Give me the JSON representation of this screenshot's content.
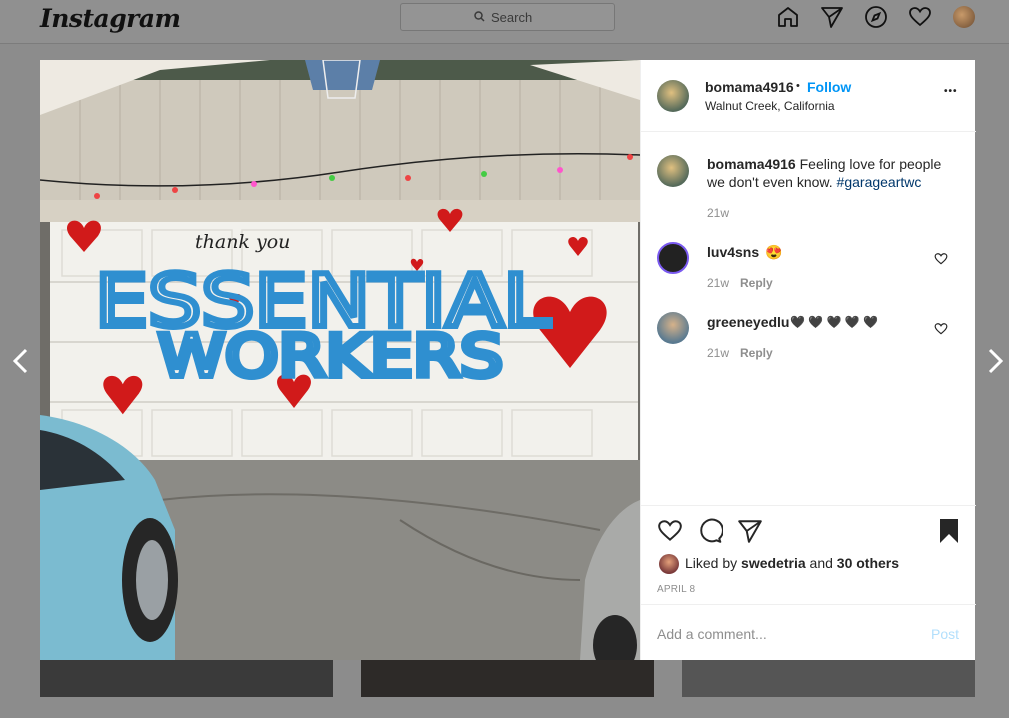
{
  "app": {
    "logo_text": "Instagram"
  },
  "topbar": {
    "search_placeholder": "Search",
    "icons": [
      "home-icon",
      "direct-icon",
      "explore-icon",
      "activity-icon",
      "profile-avatar"
    ]
  },
  "post": {
    "username": "bomama4916",
    "separator": "•",
    "follow_label": "Follow",
    "location": "Walnut Creek, California",
    "more_label": "•••",
    "image": {
      "door_text_small": "thank you",
      "door_text_line1": "ESSENTIAL",
      "door_text_line2": "WORKERS"
    },
    "caption": {
      "username": "bomama4916",
      "text": "Feeling love for people we don't even know.",
      "hashtag": "#garageartwc",
      "time": "21w"
    },
    "comments": [
      {
        "username": "luv4sns",
        "text": "😍",
        "time": "21w",
        "reply_label": "Reply"
      },
      {
        "username": "greeneyedlu",
        "text": "🖤 🖤 🖤 🖤 🖤",
        "time": "21w",
        "reply_label": "Reply"
      }
    ],
    "likes": {
      "prefix": "Liked by",
      "user": "swedetria",
      "conj": "and",
      "others": "30 others"
    },
    "date": "APRIL 8",
    "add_comment_placeholder": "Add a comment...",
    "post_button": "Post"
  },
  "colors": {
    "link_blue": "#0095f6",
    "text": "#262626",
    "muted": "#8e8e8e",
    "heart_red": "#d11a1a",
    "paint_blue": "#2f8fd0"
  }
}
